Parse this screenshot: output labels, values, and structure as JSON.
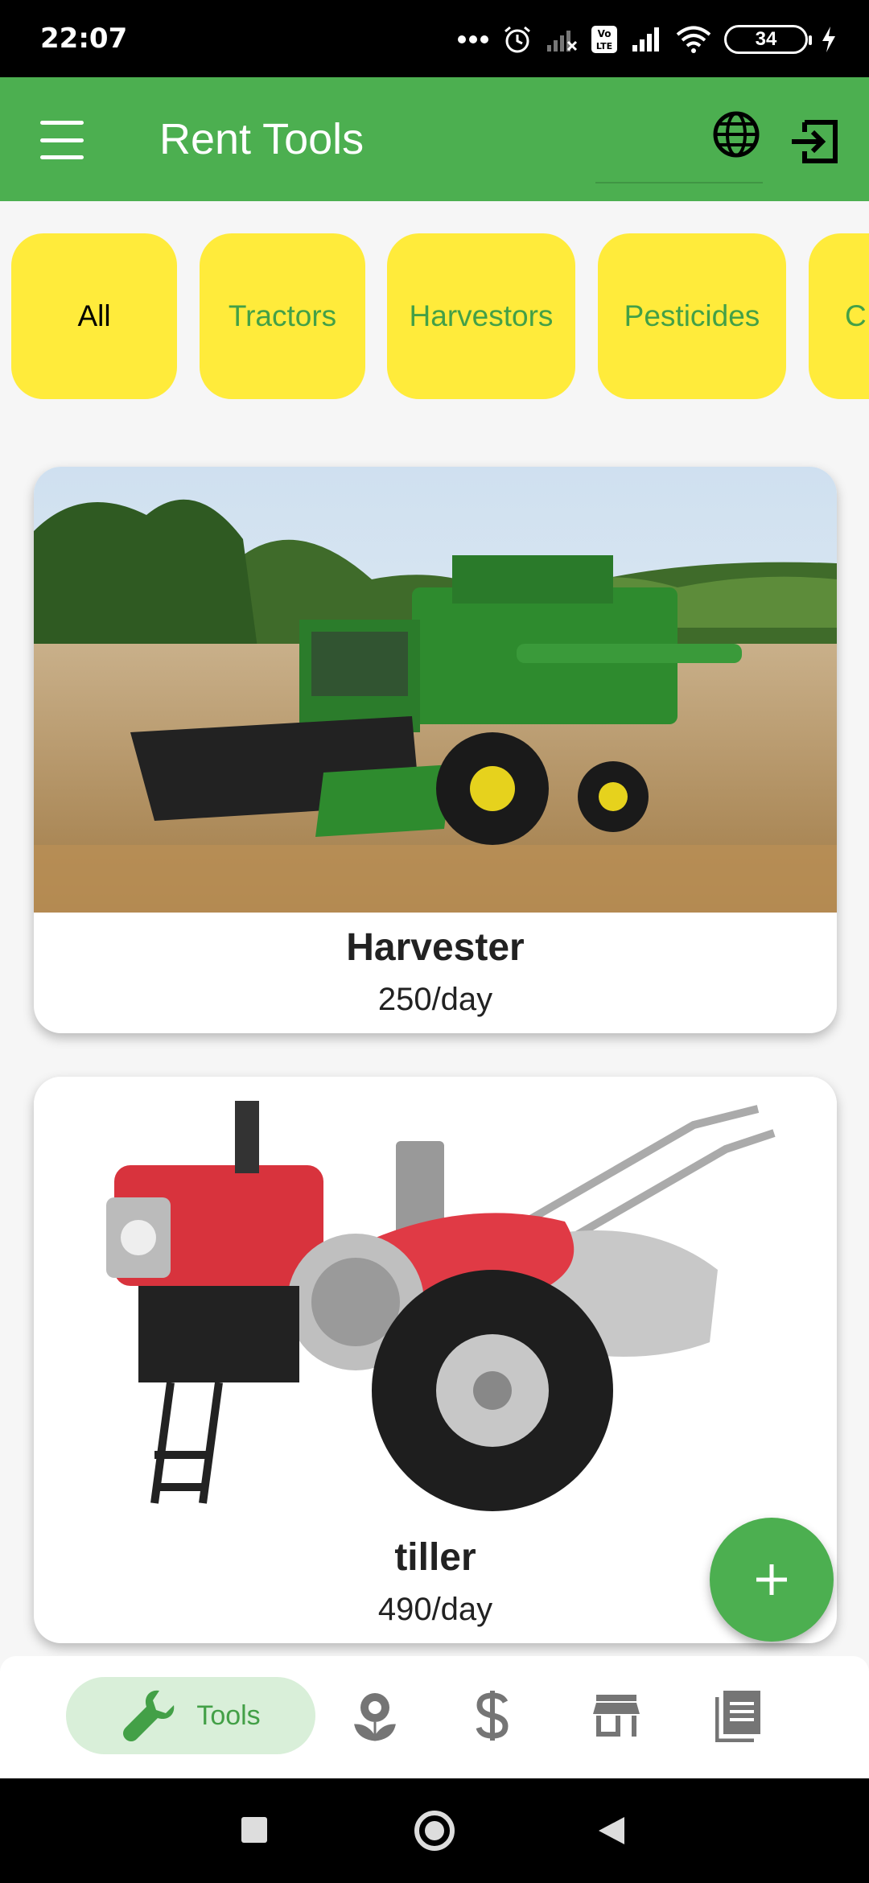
{
  "status_bar": {
    "time": "22:07",
    "battery": "34",
    "icons": [
      "more-dots-icon",
      "alarm-icon",
      "signal-off-icon",
      "volte-icon",
      "signal-icon",
      "wifi-icon",
      "battery-icon",
      "charging-icon"
    ]
  },
  "app_bar": {
    "title": "Rent Tools",
    "menu_icon": "menu-icon",
    "language_icon": "globe-icon",
    "logout_icon": "logout-icon"
  },
  "categories": [
    {
      "label": "All",
      "active": true
    },
    {
      "label": "Tractors",
      "active": false
    },
    {
      "label": "Harvestors",
      "active": false
    },
    {
      "label": "Pesticides",
      "active": false
    },
    {
      "label": "C",
      "active": false
    }
  ],
  "tools": [
    {
      "name": "Harvester",
      "price": "250/day",
      "image": "combine-harvester-photo"
    },
    {
      "name": "tiller",
      "price": "490/day",
      "image": "power-tiller-photo"
    }
  ],
  "fab": {
    "icon": "plus-icon"
  },
  "bottom_nav": {
    "items": [
      {
        "label": "Tools",
        "icon": "wrench-icon",
        "active": true
      },
      {
        "icon": "flower-icon"
      },
      {
        "icon": "dollar-icon"
      },
      {
        "icon": "store-icon"
      },
      {
        "icon": "document-icon"
      }
    ]
  },
  "colors": {
    "primary": "#4caf50",
    "chip": "#ffeb3b",
    "chip_text": "#43a047",
    "nav_active_bg": "#d9efd9"
  }
}
